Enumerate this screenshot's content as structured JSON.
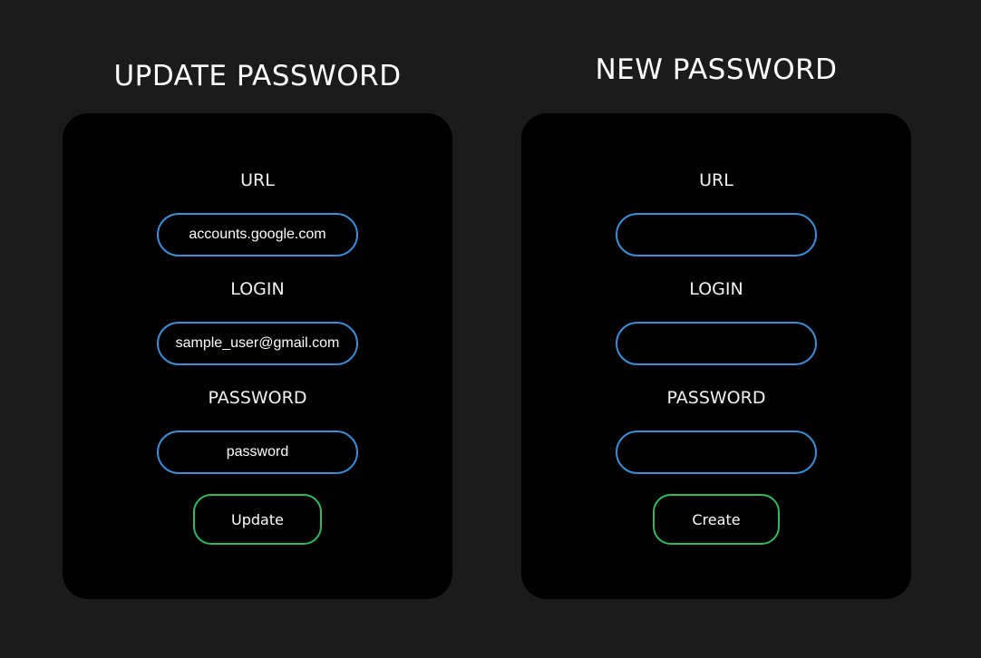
{
  "update_form": {
    "title": "UPDATE PASSWORD",
    "url_label": "URL",
    "url_value": "accounts.google.com",
    "login_label": "LOGIN",
    "login_value": "sample_user@gmail.com",
    "password_label": "PASSWORD",
    "password_value": "password",
    "button_label": "Update"
  },
  "new_form": {
    "title": "NEW PASSWORD",
    "url_label": "URL",
    "url_value": "",
    "login_label": "LOGIN",
    "login_value": "",
    "password_label": "PASSWORD",
    "password_value": "",
    "button_label": "Create"
  },
  "colors": {
    "page_background": "#1b1b1b",
    "card_background": "#000000",
    "input_border": "#3a8ed6",
    "button_border": "#2ebc5f"
  }
}
